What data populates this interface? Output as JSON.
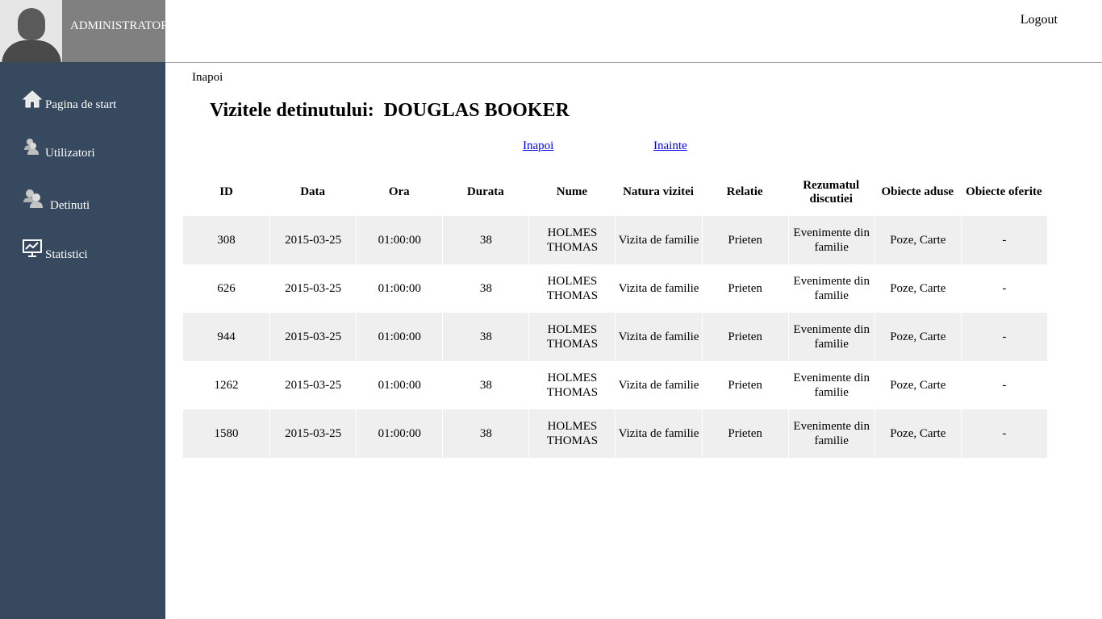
{
  "user": {
    "role": "ADMINISTRATOR"
  },
  "header": {
    "logout": "Logout"
  },
  "sidebar": {
    "items": [
      {
        "label": "Pagina de start",
        "icon": "home-icon"
      },
      {
        "label": "Utilizatori",
        "icon": "users-icon"
      },
      {
        "label": "Detinuti",
        "icon": "inmates-icon"
      },
      {
        "label": "Statistici",
        "icon": "chart-icon"
      }
    ]
  },
  "nav": {
    "back": "Inapoi"
  },
  "page": {
    "title": "Vizitele detinutului:  DOUGLAS BOOKER"
  },
  "pager": {
    "prev": "Inapoi",
    "next": "Inainte"
  },
  "table": {
    "headers": [
      "ID",
      "Data",
      "Ora",
      "Durata",
      "Nume",
      "Natura vizitei",
      "Relatie",
      "Rezumatul discutiei",
      "Obiecte aduse",
      "Obiecte oferite"
    ],
    "rows": [
      [
        "308",
        "2015-03-25",
        "01:00:00",
        "38",
        "HOLMES THOMAS",
        "Vizita de familie",
        "Prieten",
        "Evenimente din familie",
        "Poze, Carte",
        "-"
      ],
      [
        "626",
        "2015-03-25",
        "01:00:00",
        "38",
        "HOLMES THOMAS",
        "Vizita de familie",
        "Prieten",
        "Evenimente din familie",
        "Poze, Carte",
        "-"
      ],
      [
        "944",
        "2015-03-25",
        "01:00:00",
        "38",
        "HOLMES THOMAS",
        "Vizita de familie",
        "Prieten",
        "Evenimente din familie",
        "Poze, Carte",
        "-"
      ],
      [
        "1262",
        "2015-03-25",
        "01:00:00",
        "38",
        "HOLMES THOMAS",
        "Vizita de familie",
        "Prieten",
        "Evenimente din familie",
        "Poze, Carte",
        "-"
      ],
      [
        "1580",
        "2015-03-25",
        "01:00:00",
        "38",
        "HOLMES THOMAS",
        "Vizita de familie",
        "Prieten",
        "Evenimente din familie",
        "Poze, Carte",
        "-"
      ]
    ]
  },
  "colors": {
    "sidebar": "#36495e",
    "profile": "#808080",
    "row_alt": "#efefef",
    "link": "#0000ee"
  }
}
